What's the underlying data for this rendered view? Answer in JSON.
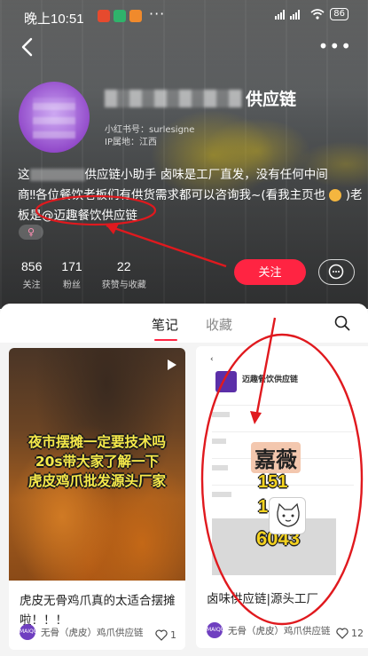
{
  "status_bar": {
    "time": "晚上10:51",
    "dots": "···",
    "battery": "86"
  },
  "profile": {
    "name_suffix": "供应链",
    "xhs_id": "小红书号：surlesigne",
    "ip_location": "IP属地：江西",
    "bio_line1_prefix": "这",
    "bio_line1_suffix": "供应链小助手 卤味是工厂直发，没有任何中间",
    "bio_line2": "商‼各位餐饮老板们有供货需求都可以咨询我~(看我主页也",
    "bio_line2_end": ")老",
    "bio_line3": "板是@迈趣餐饮供应链",
    "gender": "♀"
  },
  "stats": [
    {
      "value": "856",
      "label": "关注"
    },
    {
      "value": "171",
      "label": "粉丝"
    },
    {
      "value": "22",
      "label": "获赞与收藏"
    }
  ],
  "buttons": {
    "follow": "关注"
  },
  "tabs": {
    "notes": "笔记",
    "favorites": "收藏"
  },
  "notes": [
    {
      "thumb_lines": [
        "夜市摆摊一定要技术吗",
        "20s带大家了解一下",
        "虎皮鸡爪批发源头厂家"
      ],
      "title": "虎皮无骨鸡爪真的太适合摆摊啦！！！",
      "author": "无骨（虎皮）鸡爪供应链",
      "likes": "1"
    },
    {
      "thumb_header": "迈趣餐饮供应链",
      "thumb_wm_name": "嘉薇",
      "thumb_wm_numbers": [
        "151",
        "1",
        "6043"
      ],
      "title": "卤味供应链|源头工厂",
      "author": "无骨（虎皮）鸡爪供应链",
      "likes": "12"
    }
  ],
  "colors": {
    "accent": "#ff2442",
    "annotation": "#e0191e"
  }
}
